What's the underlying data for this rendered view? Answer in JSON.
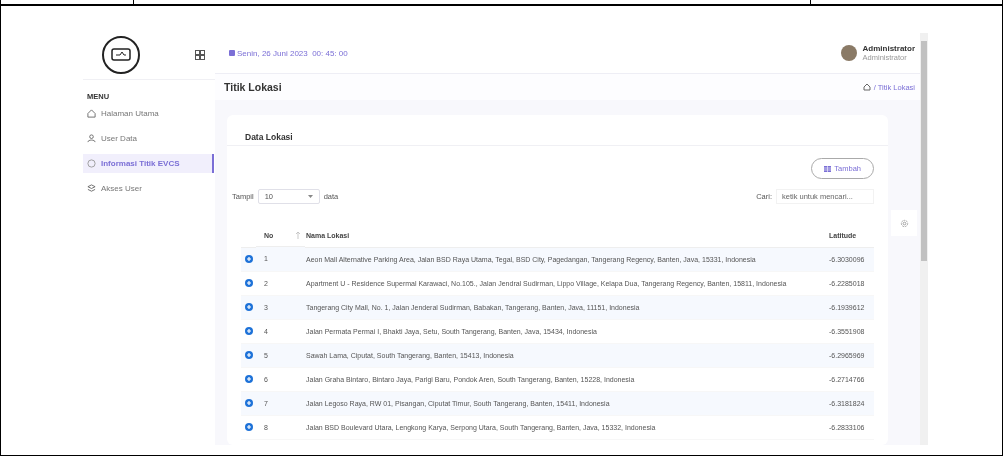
{
  "header": {
    "date": "Senin, 26 Juni 2023  00: 45: 00",
    "user_name": "Administrator",
    "user_role": "Administrator"
  },
  "sidebar": {
    "menu_label": "MENU",
    "items": [
      {
        "label": "Halaman Utama",
        "selected": false
      },
      {
        "label": "User Data",
        "selected": false
      },
      {
        "label": "Informasi Titik EVCS",
        "selected": true
      },
      {
        "label": "Akses User",
        "selected": false
      }
    ]
  },
  "page": {
    "title": "Titik Lokasi",
    "breadcrumb": "/ Titik Lokasi"
  },
  "card": {
    "title": "Data Lokasi",
    "add_button": "Tambah",
    "show_label": "Tampil",
    "show_value": "10",
    "show_suffix": "data",
    "search_label": "Cari:",
    "search_placeholder": "ketik untuk mencari..."
  },
  "table": {
    "columns": [
      "No",
      "Nama Lokasi",
      "Latitude"
    ],
    "rows": [
      {
        "no": "1",
        "name": "Aeon Mall Alternative Parking Area, Jalan BSD Raya Utama, Tegal, BSD City, Pagedangan, Tangerang Regency, Banten, Java, 15331, Indonesia",
        "latitude": "-6.3030096"
      },
      {
        "no": "2",
        "name": "Apartment U - Residence Supermal Karawaci, No.105., Jalan Jendral Sudirman, Lippo Village, Kelapa Dua, Tangerang Regency, Banten, 15811, Indonesia",
        "latitude": "-6.2285018"
      },
      {
        "no": "3",
        "name": "Tangerang City Mall, No. 1, Jalan Jenderal Sudirman, Babakan, Tangerang, Banten, Java, 11151, Indonesia",
        "latitude": "-6.1939612"
      },
      {
        "no": "4",
        "name": "Jalan Permata Permai I, Bhakti Jaya, Setu, South Tangerang, Banten, Java, 15434, Indonesia",
        "latitude": "-6.3551908"
      },
      {
        "no": "5",
        "name": "Sawah Lama, Ciputat, South Tangerang, Banten, 15413, Indonesia",
        "latitude": "-6.2965969"
      },
      {
        "no": "6",
        "name": "Jalan Graha Bintaro, Bintaro Jaya, Parigi Baru, Pondok Aren, South Tangerang, Banten, 15228, Indonesia",
        "latitude": "-6.2714766"
      },
      {
        "no": "7",
        "name": "Jalan Legoso Raya, RW 01, Pisangan, Ciputat Timur, South Tangerang, Banten, 15411, Indonesia",
        "latitude": "-6.3181824"
      },
      {
        "no": "8",
        "name": "Jalan BSD Boulevard Utara, Lengkong Karya, Serpong Utara, South Tangerang, Banten, Java, 15332, Indonesia",
        "latitude": "-6.2833106"
      }
    ]
  }
}
